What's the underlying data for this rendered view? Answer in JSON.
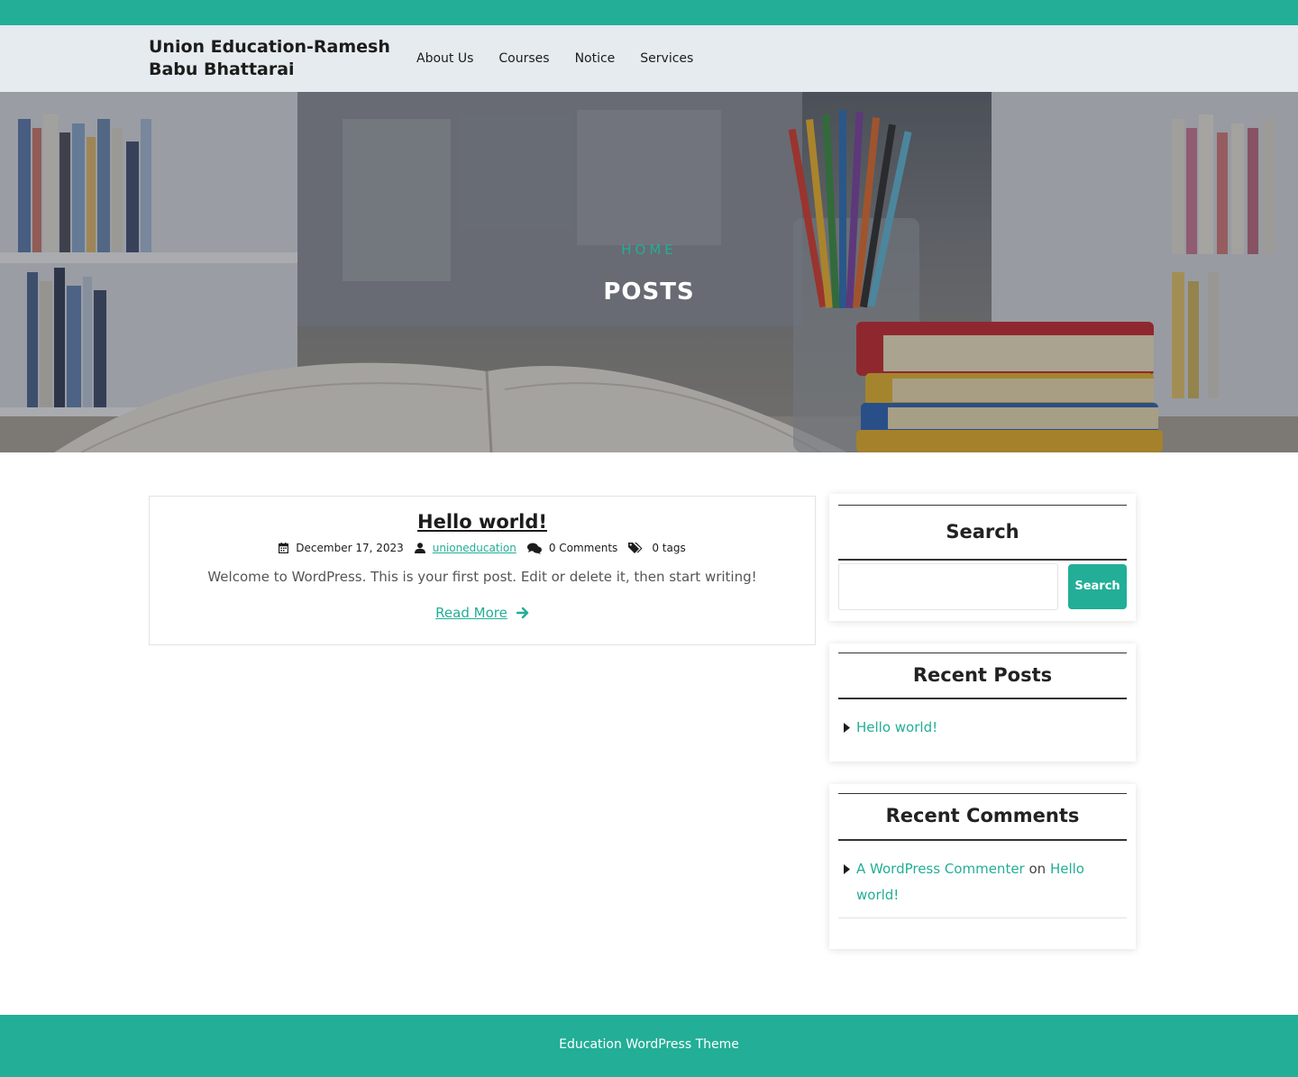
{
  "site": {
    "title": "Union Education-Ramesh Babu Bhattarai"
  },
  "nav": {
    "items": [
      "About Us",
      "Courses",
      "Notice",
      "Services"
    ]
  },
  "hero": {
    "breadcrumb": "HOME",
    "title": "POSTS"
  },
  "post": {
    "title": "Hello world!",
    "date": "December 17, 2023",
    "author": "unioneducation",
    "comments": "0 Comments",
    "tags": "0 tags",
    "excerpt": "Welcome to WordPress. This is your first post. Edit or delete it, then start writing!",
    "read_more": "Read More"
  },
  "sidebar": {
    "search": {
      "title": "Search",
      "placeholder": "",
      "button": "Search"
    },
    "recent_posts": {
      "title": "Recent Posts",
      "items": [
        "Hello world!"
      ]
    },
    "recent_comments": {
      "title": "Recent Comments",
      "author": "A WordPress Commenter",
      "on": "on",
      "post_line1": "Hello",
      "post_line2": "world!"
    }
  },
  "footer": {
    "text": "Education WordPress Theme"
  },
  "colors": {
    "accent": "#22ae97",
    "header_bg": "#e5ebee",
    "text_dark": "#1c1c1c"
  }
}
